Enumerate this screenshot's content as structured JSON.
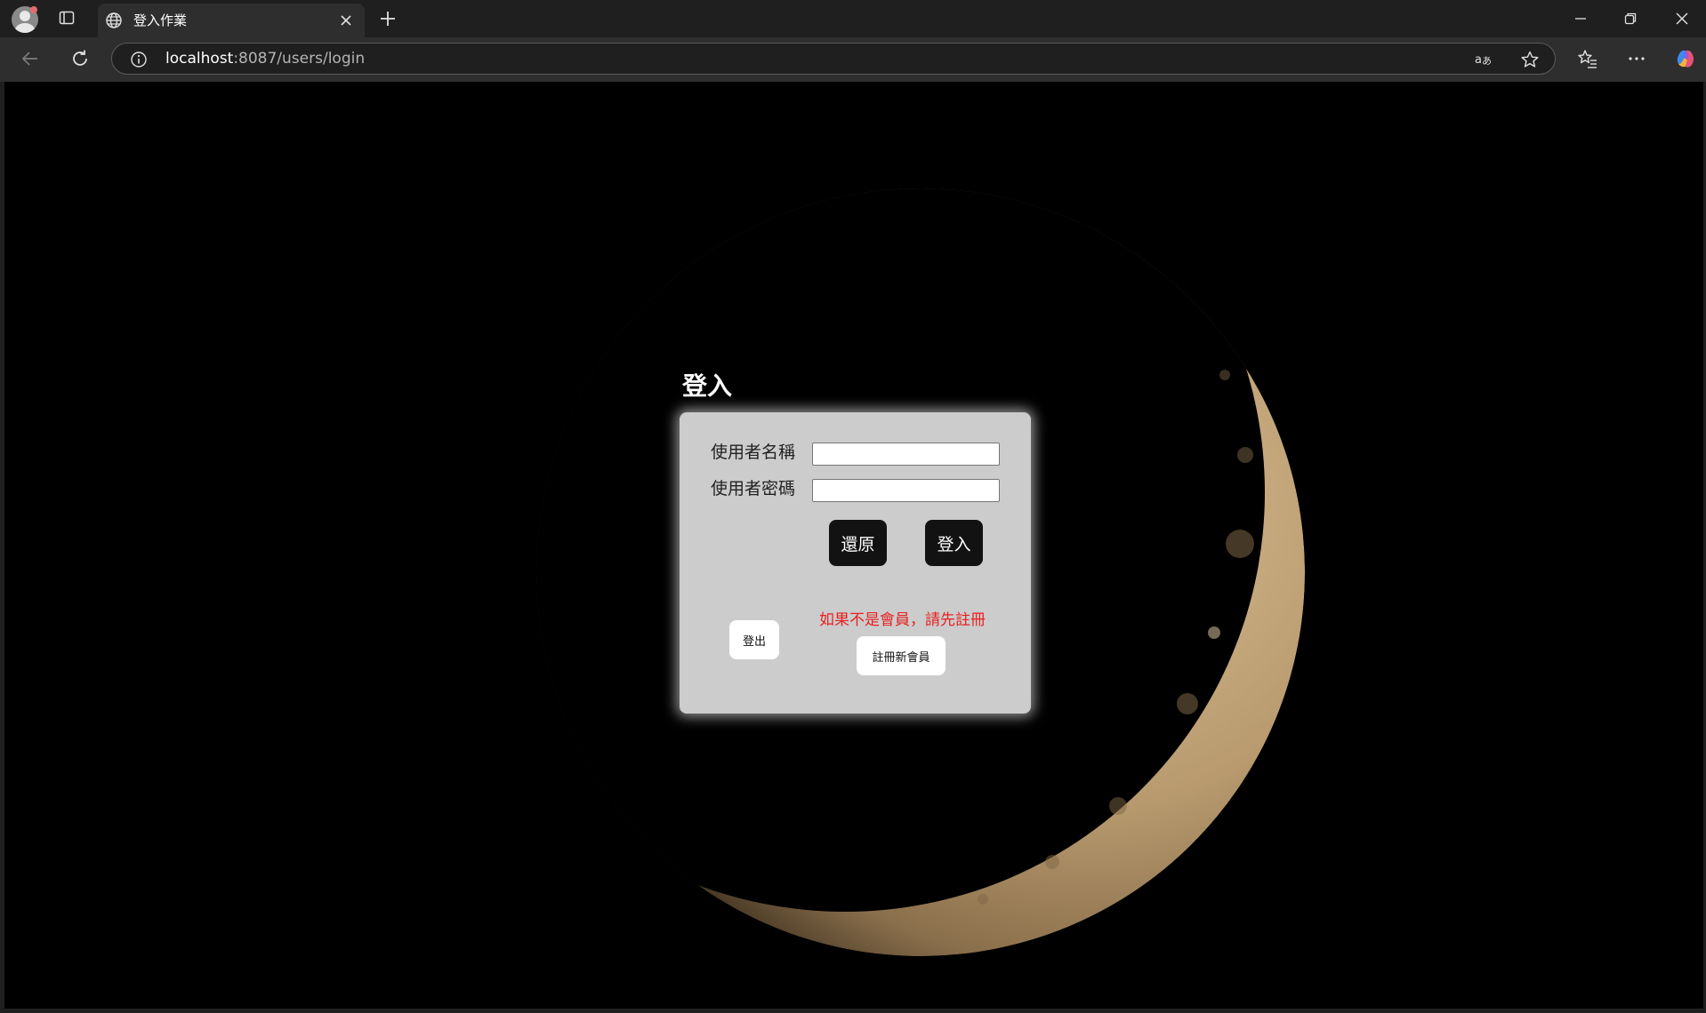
{
  "browser": {
    "tab_title": "登入作業",
    "url_host": "localhost",
    "url_path": ":8087/users/login"
  },
  "page": {
    "title": "登入",
    "username_label": "使用者名稱",
    "username_value": "",
    "password_label": "使用者密碼",
    "password_value": "",
    "reset_button": "還原",
    "login_button": "登入",
    "logout_button": "登出",
    "register_notice": "如果不是會員，請先註冊",
    "register_button": "註冊新會員"
  },
  "colors": {
    "panel_bg": "#cccccc",
    "dark_button": "#121212",
    "notice_text": "#e82020"
  }
}
